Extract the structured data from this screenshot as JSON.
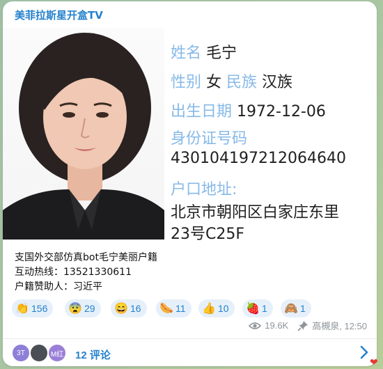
{
  "channel": {
    "name": "美菲拉斯星开盒TV"
  },
  "card": {
    "name_label": "姓名",
    "name": "毛宁",
    "gender_label": "性别",
    "gender": "女",
    "ethnicity_label": "民族",
    "ethnicity": "汉族",
    "dob_label": "出生日期",
    "dob": "1972-12-06",
    "id_label": "身份证号码",
    "id_number": "430104197212064640",
    "address_label": "户口地址:",
    "address_line1": "北京市朝阳区白家庄东里",
    "address_line2": "23号C25F"
  },
  "caption": {
    "line1": "支国外交部仿真bot毛宁美丽户籍",
    "line2": "互动热线：13521330611",
    "line3": "户籍赞助人：习近平"
  },
  "reactions": [
    {
      "emoji": "👏",
      "count": "156",
      "color": "#f6b33a"
    },
    {
      "emoji": "😨",
      "count": "29",
      "color": "#f6b33a"
    },
    {
      "emoji": "😄",
      "count": "16",
      "color": "#f6b33a"
    },
    {
      "emoji": "🌭",
      "count": "11",
      "color": "#d9783a"
    },
    {
      "emoji": "👍",
      "count": "10",
      "color": "#f6b33a"
    },
    {
      "emoji": "🍓",
      "count": "1",
      "color": "#e23b3b"
    },
    {
      "emoji": "🙈",
      "count": "1",
      "color": "#9c6b45"
    }
  ],
  "meta": {
    "views": "19.6K",
    "author_time": "高槻泉, 12:50"
  },
  "comments": {
    "label": "12 评论",
    "avatars": [
      {
        "text": "3T",
        "color": "#8e7fd8"
      },
      {
        "text": "",
        "color": "#4a4f55"
      },
      {
        "text": "M红",
        "color": "#9a7fd8"
      }
    ]
  },
  "icons": {
    "eye": "eye-icon",
    "pin": "pin-icon",
    "chevron": "chevron-right-icon",
    "heart": "heart-icon"
  }
}
